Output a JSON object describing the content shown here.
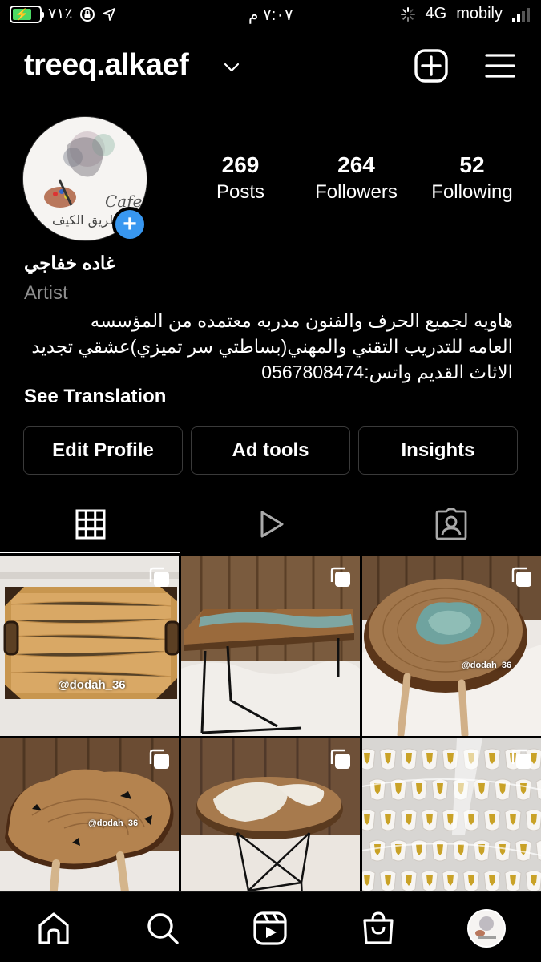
{
  "status_bar": {
    "battery_percent": "٧١٪",
    "time": "٧:٠٧ م",
    "network": "4G",
    "carrier": "mobily",
    "battery_level": 0.71
  },
  "header": {
    "username": "treeq.alkaef"
  },
  "profile": {
    "avatar_text": "Cafe",
    "avatar_arabic": "طريق الكيف",
    "stats": {
      "posts_count": "269",
      "posts_label": "Posts",
      "followers_count": "264",
      "followers_label": "Followers",
      "following_count": "52",
      "following_label": "Following"
    },
    "display_name": "غاده خفاجي",
    "category": "Artist",
    "bio_lines": [
      "هاويه لجميع الحرف والفنون مدربه معتمده من المؤسسه",
      "العامه للتدريب التقني والمهني(بساطتي سر تميزي)عشقي تجديد",
      "الاثاث القديم واتس:0567808474"
    ],
    "see_translation": "See Translation"
  },
  "actions": {
    "edit_profile": "Edit Profile",
    "ad_tools": "Ad tools",
    "insights": "Insights"
  },
  "tabs": [
    "grid-icon",
    "reels-icon",
    "tagged-icon"
  ],
  "grid": {
    "watermarks": {
      "post1": "@dodah_36",
      "post3": "@dodah_36",
      "post4": "@dodah_36"
    }
  },
  "bottom_nav": [
    "home-icon",
    "search-icon",
    "reels-icon",
    "shop-icon",
    "profile-avatar"
  ],
  "colors": {
    "background": "#000000",
    "accent_blue": "#3897f0",
    "battery_green": "#4cd964",
    "secondary_text": "#8e8e8e",
    "button_border": "#3a3a3a"
  }
}
